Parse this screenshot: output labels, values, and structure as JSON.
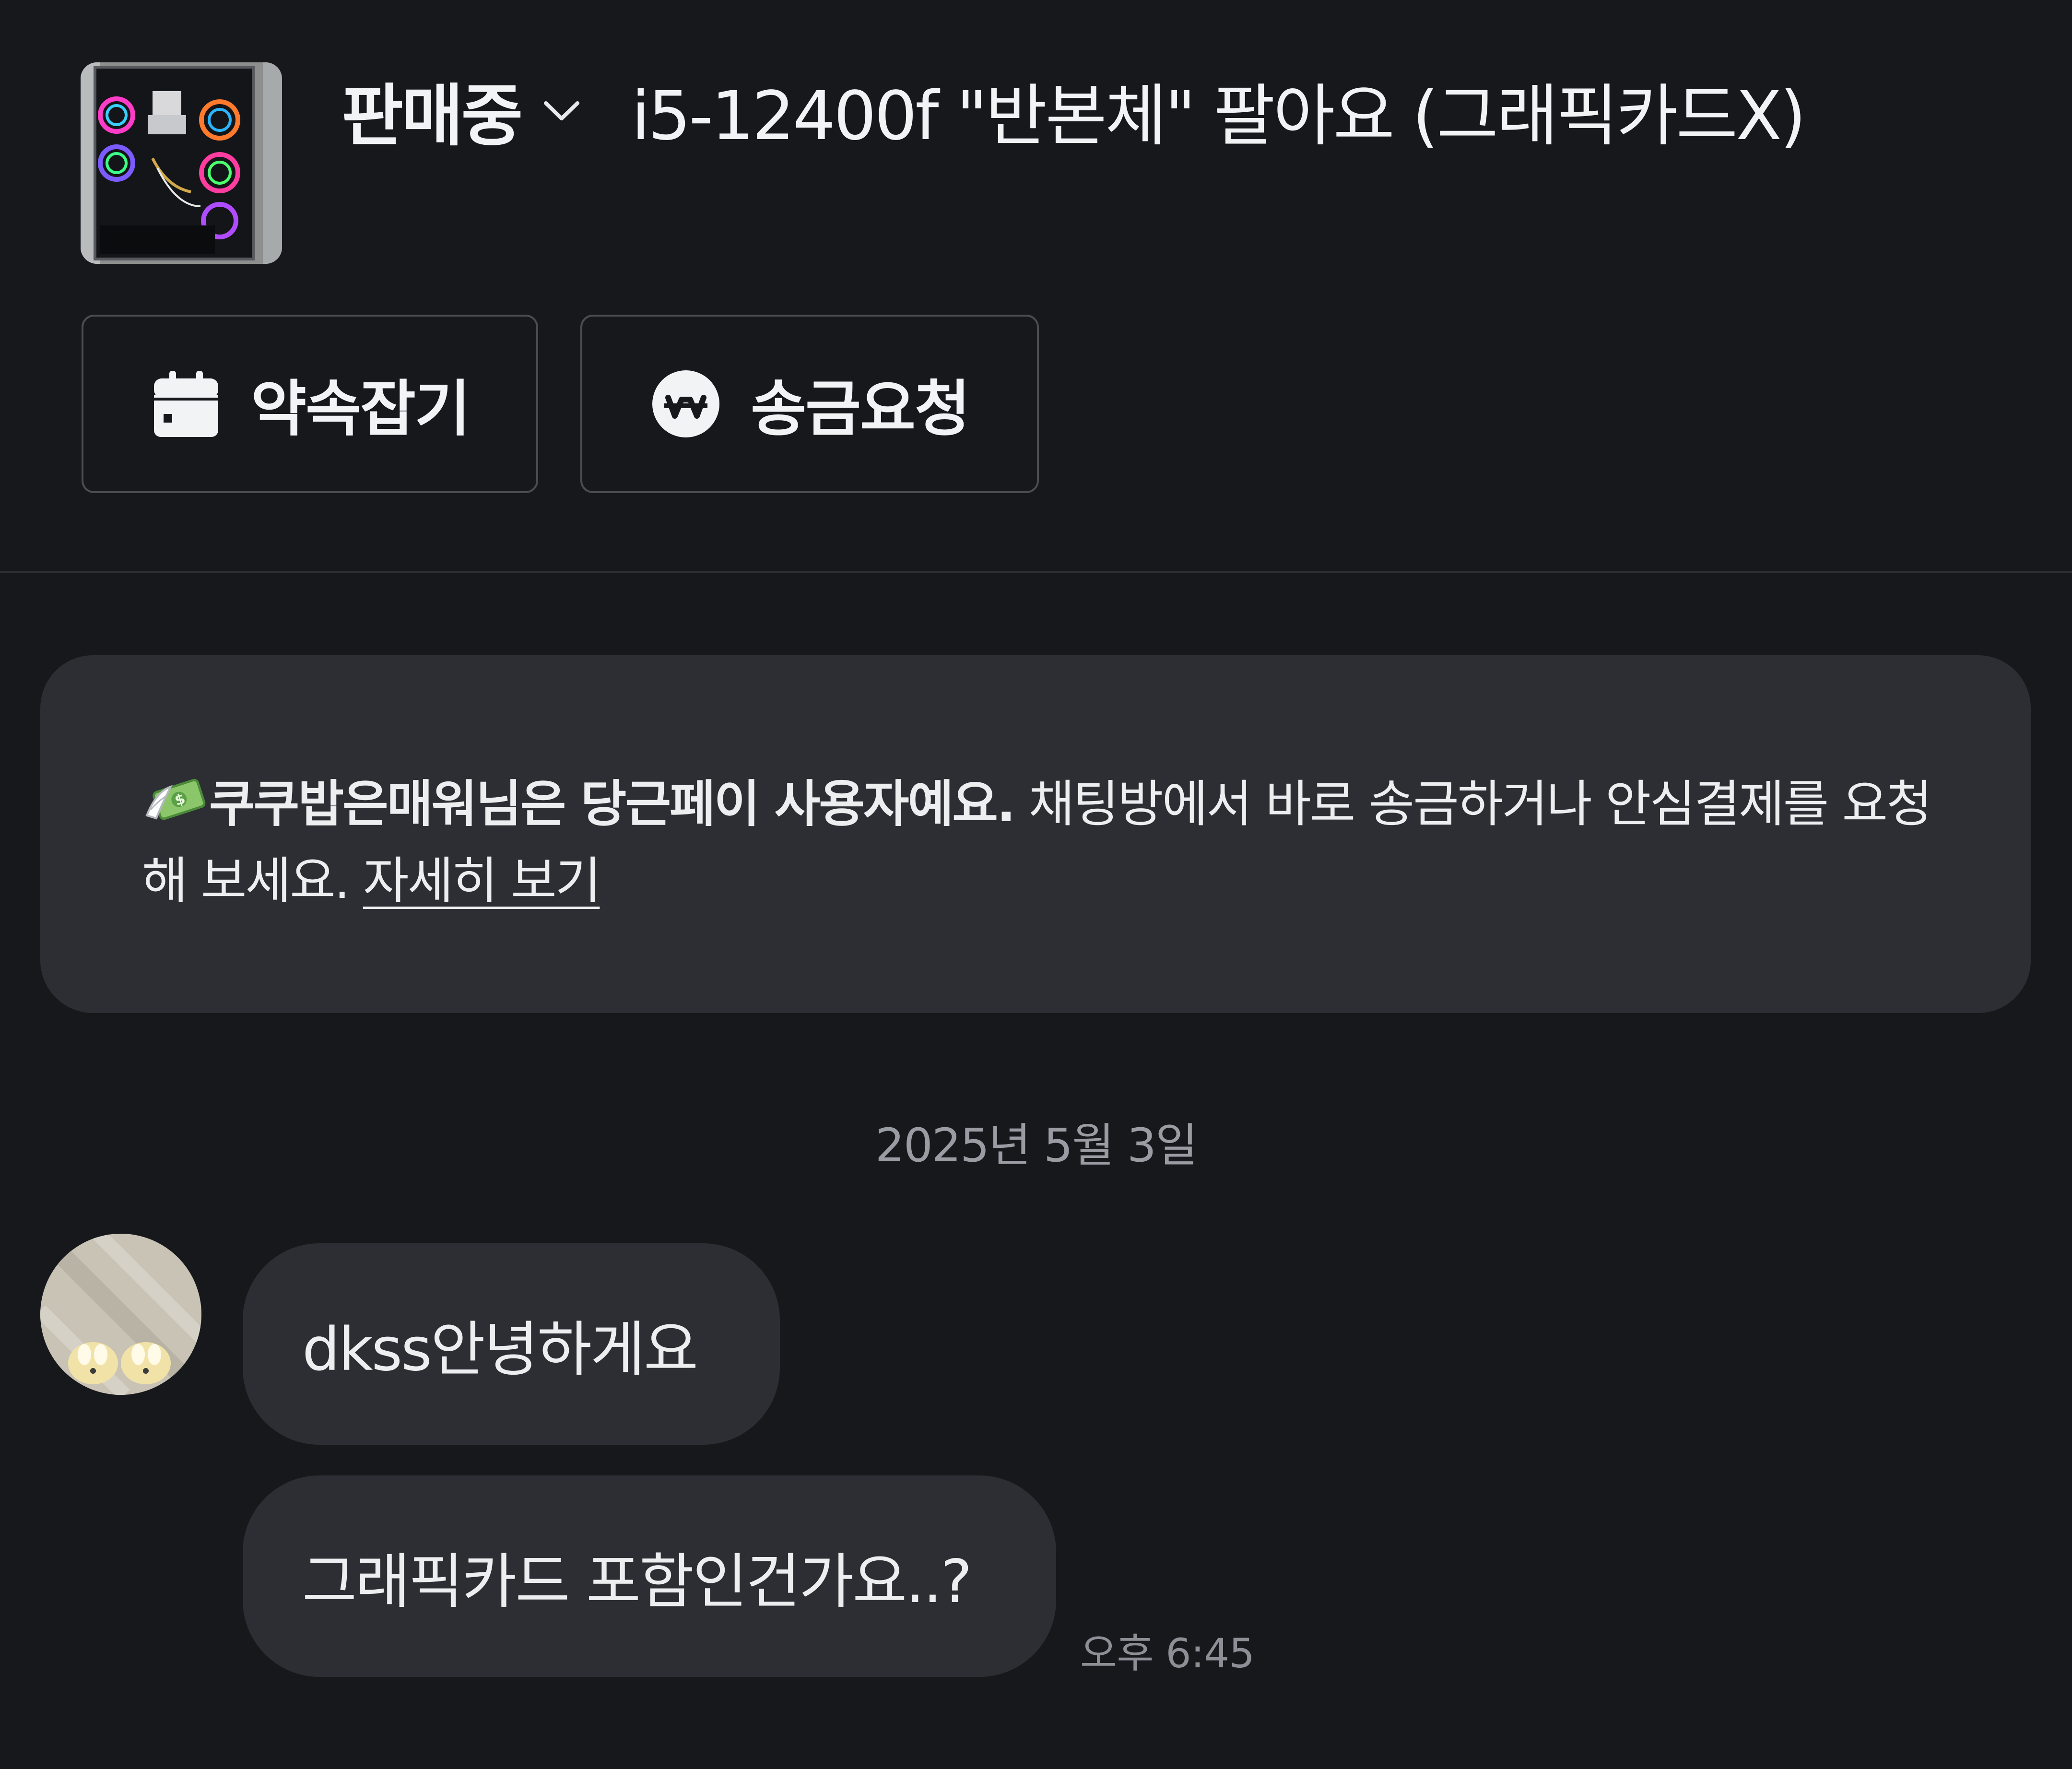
{
  "header": {
    "status_label": "판매중",
    "title": "i5-12400f \"반본체\" 팔아요 (그래픽카드X)",
    "thumbnail_icon": "pc-case-rgb-photo"
  },
  "actions": {
    "appointment_label": "약속잡기",
    "appointment_icon": "calendar-icon",
    "remit_label": "송금요청",
    "remit_icon": "won-coin-icon"
  },
  "notice": {
    "emoji": "money-with-wings-icon",
    "bold_text": "쿠쿠밥은매워님은 당근페이 사용자예요.",
    "text": " 채팅방에서 바로 송금하거나 안심결제를 요청해 보세요. ",
    "link_label": "자세히 보기"
  },
  "chat": {
    "date_separator": "2025년 5월 3일",
    "partner_avatar_icon": "user-avatar-photo",
    "messages": [
      {
        "text": "dkss안녕하게요"
      },
      {
        "text": "그래픽카드 포함인건가요..?"
      }
    ],
    "last_time": "오후 6:45"
  },
  "colors": {
    "background": "#17181c",
    "card": "#2c2e33",
    "text_primary": "#f2f3f5",
    "text_muted": "#9a9ca3"
  }
}
